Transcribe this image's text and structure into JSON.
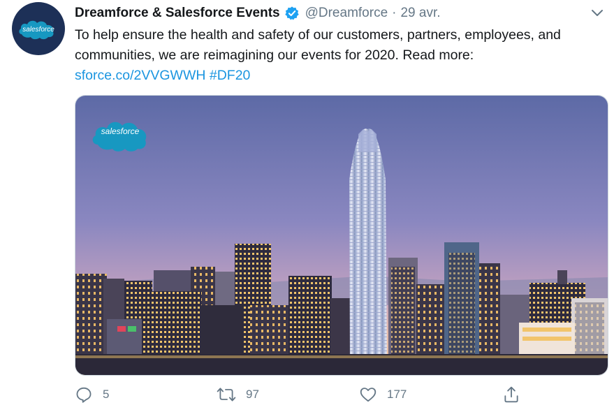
{
  "tweet": {
    "author": {
      "display_name": "Dreamforce & Salesforce Events",
      "handle": "@Dreamforce",
      "verified": true,
      "avatar_logo_text": "salesforce"
    },
    "separator": "·",
    "date": "29 avr.",
    "text_body": "To help ensure the health and safety of our customers, partners, employees, and communities, we are reimagining our events for 2020. Read more:",
    "link": "sforce.co/2VVGWWH",
    "hashtag": "#DF20",
    "media": {
      "logo_text": "salesforce",
      "description_icon": "city-skyline-image"
    },
    "actions": {
      "reply_count": "5",
      "retweet_count": "97",
      "like_count": "177"
    },
    "icons": {
      "reply": "reply-icon",
      "retweet": "retweet-icon",
      "like": "heart-icon",
      "share": "share-icon",
      "menu": "chevron-down-icon",
      "verified": "verified-badge-icon"
    },
    "colors": {
      "link": "#1b95e0",
      "verified": "#1da1f2",
      "secondary_text": "#657786",
      "salesforce_blue": "#1798c1"
    }
  }
}
